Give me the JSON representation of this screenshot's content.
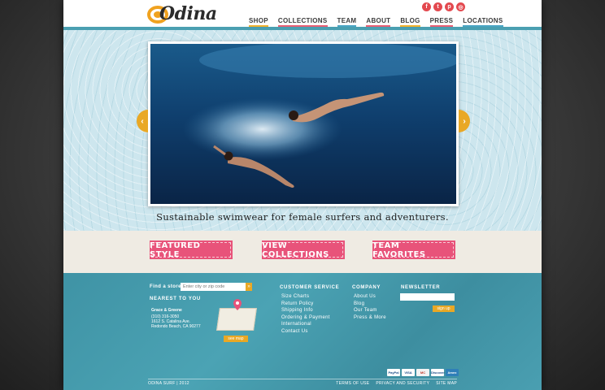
{
  "header": {
    "logo_text": "Odina",
    "social_icons": [
      "facebook-icon",
      "twitter-icon",
      "pinterest-icon",
      "instagram-icon"
    ],
    "nav": [
      "SHOP",
      "COLLECTIONS",
      "TEAM",
      "ABOUT",
      "BLOG",
      "PRESS",
      "LOCATIONS"
    ]
  },
  "hero": {
    "tagline": "Sustainable swimwear for female surfers and adventurers.",
    "prev_icon": "chevron-left-icon",
    "next_icon": "chevron-right-icon"
  },
  "feature_buttons": [
    "FEATURED STYLE",
    "VIEW COLLECTIONS",
    "TEAM FAVORITES"
  ],
  "footer": {
    "find_label": "Find a store:",
    "find_placeholder": "Enter city or zip code",
    "find_go": "»",
    "nearest_heading": "NEAREST TO YOU",
    "store": {
      "name": "Grace & Greene",
      "phone": "(310) 316-3050",
      "address1": "1612 S. Catalina Ave.",
      "address2": "Redondo Beach, CA 90277"
    },
    "see_map": "see map",
    "customer_service": {
      "heading": "CUSTOMER SERVICE",
      "links": [
        "Size Charts",
        "Return Policy",
        "Shipping Info",
        "Ordering & Payment",
        "International",
        "Contact Us"
      ]
    },
    "company": {
      "heading": "COMPANY",
      "links": [
        "About Us",
        "Blog",
        "Our Team",
        "Press & More"
      ]
    },
    "newsletter": {
      "heading": "NEWSLETTER",
      "signup": "sign up"
    },
    "payments": [
      "PayPal",
      "VISA",
      "MC",
      "Discover",
      "Amex"
    ],
    "copyright": "ODINA SURF | 2012",
    "bottom_links": [
      "TERMS OF USE",
      "PRIVACY AND SECURITY",
      "SITE MAP"
    ]
  },
  "colors": {
    "accent_pink": "#e8537a",
    "accent_orange": "#e9a825",
    "footer_teal": "#4a9fb1"
  }
}
